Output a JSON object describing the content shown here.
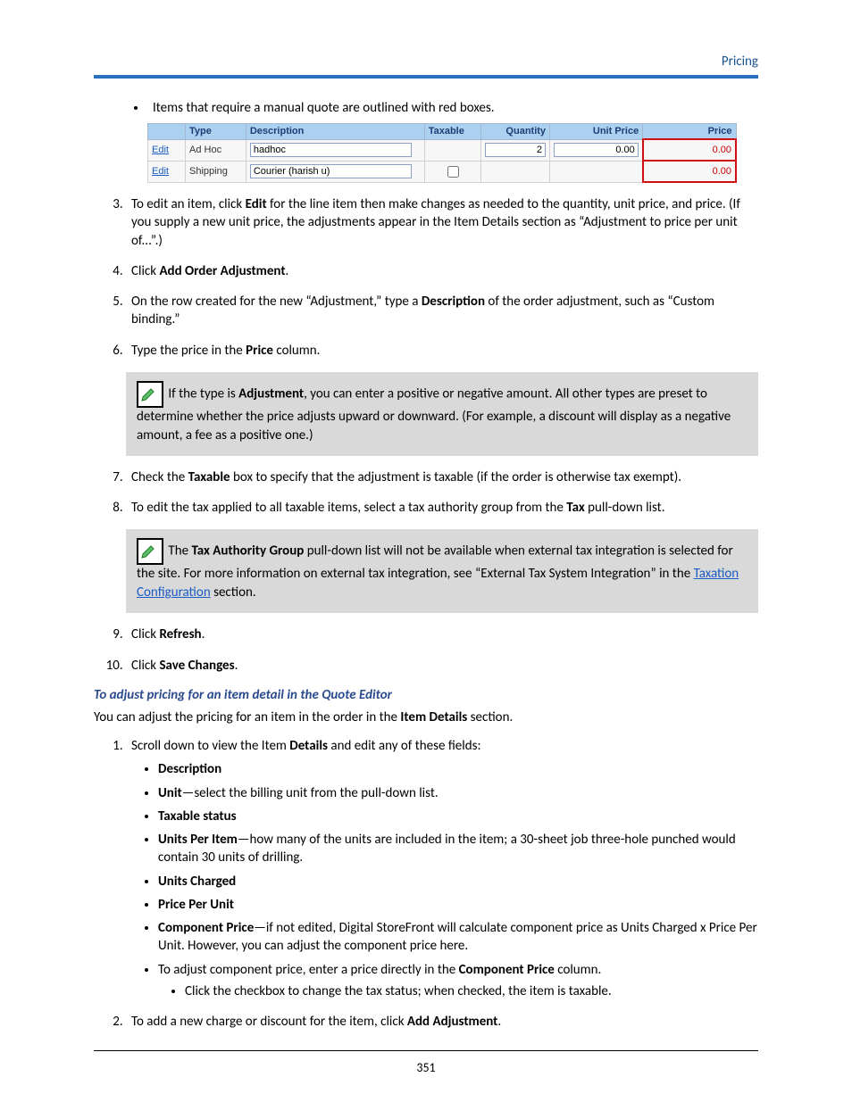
{
  "header": {
    "title": "Pricing"
  },
  "page_number": "351",
  "intro_bullet": "Items that require a manual quote are outlined with red boxes.",
  "table": {
    "headers": {
      "blank": "",
      "type": "Type",
      "description": "Description",
      "taxable": "Taxable",
      "quantity": "Quantity",
      "unit_price": "Unit Price",
      "price": "Price"
    },
    "rows": [
      {
        "edit": "Edit",
        "type": "Ad Hoc",
        "description": "hadhoc",
        "taxable_checkbox": false,
        "quantity": "2",
        "unit_price": "0.00",
        "price": "0.00",
        "price_red": true
      },
      {
        "edit": "Edit",
        "type": "Shipping",
        "description": "Courier (harish u)",
        "taxable_checkbox": true,
        "quantity": "",
        "unit_price": "",
        "price": "0.00",
        "price_red": true
      }
    ]
  },
  "step3": {
    "pre": "To edit an item, click ",
    "b1": "Edit",
    "post": " for the line item then make changes as needed to the quantity, unit price, and price. (If you supply a new unit price, the adjustments appear in the Item Details section as “Adjustment to price per unit of...”.)"
  },
  "step4": {
    "pre": "Click ",
    "b1": "Add Order Adjustment",
    "post": "."
  },
  "step5": {
    "pre": "On the row created for the new “Adjustment,” type a ",
    "b1": "Description",
    "post": " of the order adjustment, such as “Custom binding.”"
  },
  "step6": {
    "pre": "Type the price in the ",
    "b1": "Price",
    "post": " column."
  },
  "note1": {
    "pre": "If the type is ",
    "b1": "Adjustment",
    "post": ", you can enter a positive or negative amount. All other types are preset to determine whether the price adjusts upward or downward. (For example, a discount will display as a negative amount, a fee as a positive one.)"
  },
  "step7": {
    "pre": "Check the ",
    "b1": "Taxable",
    "post": " box to specify that the adjustment is taxable (if the order is otherwise tax exempt)."
  },
  "step8": {
    "pre": "To edit the tax applied to all taxable items, select a tax authority group from the ",
    "b1": "Tax",
    "post": " pull-down list."
  },
  "note2": {
    "pre": "The ",
    "b1": "Tax Authority Group",
    "mid": " pull-down list will not be available when external tax integration is selected for the site. For more information on external tax integration, see “External Tax System Integration” in the ",
    "link": "Taxation Configuration",
    "post": " section."
  },
  "step9": {
    "pre": "Click ",
    "b1": "Refresh",
    "post": "."
  },
  "step10": {
    "pre": "Click ",
    "b1": "Save Changes",
    "post": "."
  },
  "sub": {
    "heading": "To adjust pricing for an item detail in the Quote Editor"
  },
  "sub_para": {
    "pre": "You can adjust the pricing for an item in the order in the ",
    "b1": "Item Details",
    "post": " section."
  },
  "q1": {
    "pre": "Scroll down to view the Item ",
    "b1": "Details",
    "post": " and edit any of these fields:"
  },
  "q1_items": {
    "a": {
      "b": "Description"
    },
    "b": {
      "b": "Unit",
      "post": "—select the billing unit from the pull-down list."
    },
    "c": {
      "b": "Taxable status"
    },
    "d": {
      "b": "Units Per Item",
      "post": "—how many of the units are included in the item; a 30-sheet job three-hole punched would contain 30 units of drilling."
    },
    "e": {
      "b": "Units Charged"
    },
    "f": {
      "b": "Price Per Unit"
    },
    "g": {
      "b": "Component Price",
      "post": "—if not edited, Digital StoreFront will calculate component price as Units Charged x Price Per Unit. However, you can adjust the component price here."
    },
    "h": {
      "pre": "To adjust component price, enter a price directly in the ",
      "b": "Component Price",
      "post": " column."
    },
    "h_sub": "Click the checkbox to change the tax status; when checked, the item is taxable."
  },
  "q2": {
    "pre": "To add a new charge or discount for the item, click ",
    "b1": "Add Adjustment",
    "post": "."
  }
}
